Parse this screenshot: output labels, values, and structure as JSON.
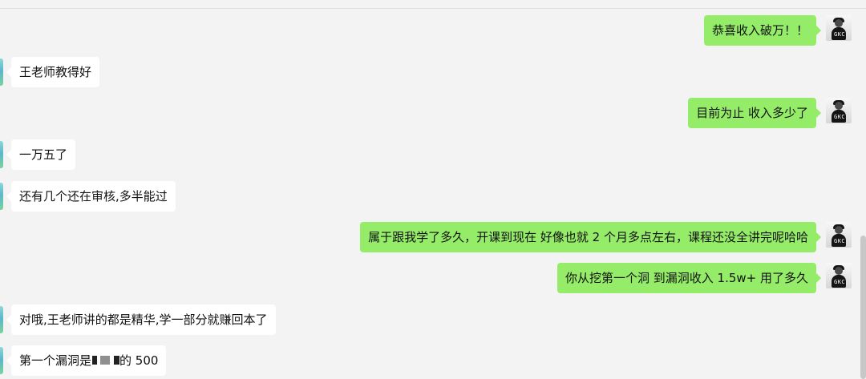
{
  "messages": [
    {
      "side": "outgoing",
      "text": "恭喜收入破万！！"
    },
    {
      "side": "incoming",
      "text": "王老师教得好"
    },
    {
      "side": "outgoing",
      "text": "目前为止 收入多少了"
    },
    {
      "side": "incoming",
      "text": "一万五了"
    },
    {
      "side": "incoming",
      "text": "还有几个还在审核,多半能过"
    },
    {
      "side": "outgoing",
      "text": "属于跟我学了多久，开课到现在 好像也就 2 个月多点左右，课程还没全讲完呢哈哈"
    },
    {
      "side": "outgoing",
      "text": "你从挖第一个洞 到漏洞收入 1.5w+ 用了多久"
    },
    {
      "side": "incoming",
      "text": "对哦,王老师讲的都是精华,学一部分就赚回本了"
    },
    {
      "side": "incoming",
      "text_prefix": "第一个漏洞是",
      "text_suffix": "的 500"
    }
  ],
  "avatar": {
    "right_label": "GKC"
  },
  "colors": {
    "background": "#f3f3f3",
    "incoming_bubble": "#ffffff",
    "outgoing_bubble": "#95ec69",
    "text": "#111111"
  },
  "icons": {
    "left_avatar": "contact-avatar-icon",
    "right_avatar": "user-avatar-icon",
    "redaction": "redacted-text-icon"
  }
}
